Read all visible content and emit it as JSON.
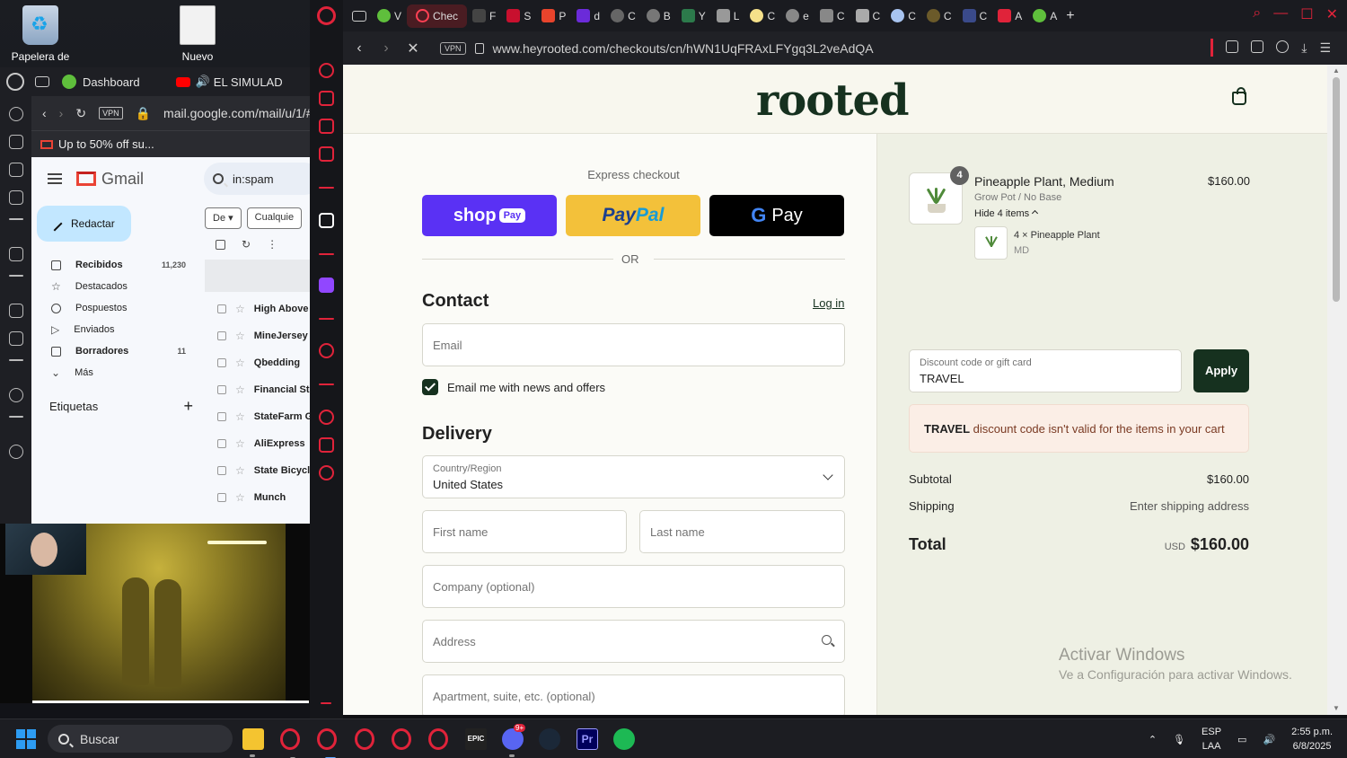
{
  "desktop": {
    "icons": [
      {
        "label": "Papelera de"
      },
      {
        "label": "Nuevo"
      }
    ]
  },
  "mini_browser": {
    "tabs": [
      {
        "label": "Dashboard"
      },
      {
        "label": "EL SIMULAD"
      }
    ],
    "url": "mail.google.com/mail/u/1/#",
    "vpn": "VPN",
    "tab_title": "Up to 50% off su...",
    "gmail": {
      "brand": "Gmail",
      "search_value": "in:spam",
      "compose_label": "Redactar",
      "nav": [
        {
          "label": "Recibidos",
          "count": "11,230",
          "bold": true
        },
        {
          "label": "Destacados",
          "count": ""
        },
        {
          "label": "Pospuestos",
          "count": ""
        },
        {
          "label": "Enviados",
          "count": ""
        },
        {
          "label": "Borradores",
          "count": "11",
          "bold": true
        },
        {
          "label": "Más",
          "count": ""
        }
      ],
      "labels_title": "Etiquetas",
      "labels_add": "+",
      "filters": [
        "De",
        "Cualquie"
      ],
      "rows": [
        "High Above",
        "MineJersey",
        "Qbedding",
        "Financial St",
        "StateFarm G",
        "AliExpress",
        "State Bicycl",
        "Munch"
      ]
    }
  },
  "tabbar": {
    "tabs": [
      {
        "label": "V",
        "color": "#5fbf3c"
      },
      {
        "label": "Chec",
        "active": true,
        "color": "#ff4054"
      },
      {
        "label": "F",
        "color": "#444"
      },
      {
        "label": "S",
        "color": "#c8102e"
      },
      {
        "label": "P",
        "color": "#e8442c"
      },
      {
        "label": "d",
        "color": "#6b2bd9"
      },
      {
        "label": "C",
        "color": "#666"
      },
      {
        "label": "B",
        "color": "#777"
      },
      {
        "label": "Y",
        "color": "#2c7a4b"
      },
      {
        "label": "L",
        "color": "#999"
      },
      {
        "label": "C",
        "color": "#f5e08a"
      },
      {
        "label": "e",
        "color": "#888"
      },
      {
        "label": "C",
        "color": "#888"
      },
      {
        "label": "C",
        "color": "#aaa"
      },
      {
        "label": "C",
        "color": "#a8c4f0"
      },
      {
        "label": "C",
        "color": "#6b5a2a"
      },
      {
        "label": "C",
        "color": "#3a4a8a"
      },
      {
        "label": "A",
        "color": "#e0233a"
      },
      {
        "label": "A",
        "color": "#5fbf3c"
      }
    ],
    "new_tab": "+"
  },
  "urlbar": {
    "vpn": "VPN",
    "url": "www.heyrooted.com/checkouts/cn/hWN1UqFRAxLFYgq3L2veAdQA"
  },
  "checkout": {
    "brand": "rooted",
    "express_title": "Express checkout",
    "shoppay_label": "shop",
    "shoppay_pill": "Pay",
    "paypal_pay": "Pay",
    "paypal_pal": "Pal",
    "gpay_g": "G",
    "gpay_label": "Pay",
    "or_label": "OR",
    "contact": {
      "title": "Contact",
      "login": "Log in",
      "email_placeholder": "Email",
      "newsletter": "Email me with news and offers",
      "newsletter_checked": true
    },
    "delivery": {
      "title": "Delivery",
      "country_label": "Country/Region",
      "country_value": "United States",
      "first_name": "First name",
      "last_name": "Last name",
      "company": "Company (optional)",
      "address": "Address",
      "apartment": "Apartment, suite, etc. (optional)"
    }
  },
  "summary": {
    "item": {
      "qty_badge": "4",
      "name": "Pineapple Plant, Medium",
      "variant": "Grow Pot / No Base",
      "hide_items": "Hide 4 items",
      "price": "$160.00",
      "sub_name": "4 × Pineapple Plant",
      "sub_variant": "MD"
    },
    "discount": {
      "label": "Discount code or gift card",
      "value": "TRAVEL",
      "apply": "Apply",
      "error_code": "TRAVEL",
      "error_text": " discount code isn't valid for the items in your cart"
    },
    "subtotal_label": "Subtotal",
    "subtotal_value": "$160.00",
    "shipping_label": "Shipping",
    "shipping_value": "Enter shipping address",
    "total_label": "Total",
    "total_currency": "USD",
    "total_value": "$160.00"
  },
  "watermark": {
    "title": "Activar Windows",
    "subtitle": "Ve a Configuración para activar Windows."
  },
  "taskbar": {
    "search": "Buscar",
    "discord_badge": "9+",
    "lang_top": "ESP",
    "lang_bottom": "LAA",
    "time": "2:55 p.m.",
    "date": "6/8/2025"
  }
}
